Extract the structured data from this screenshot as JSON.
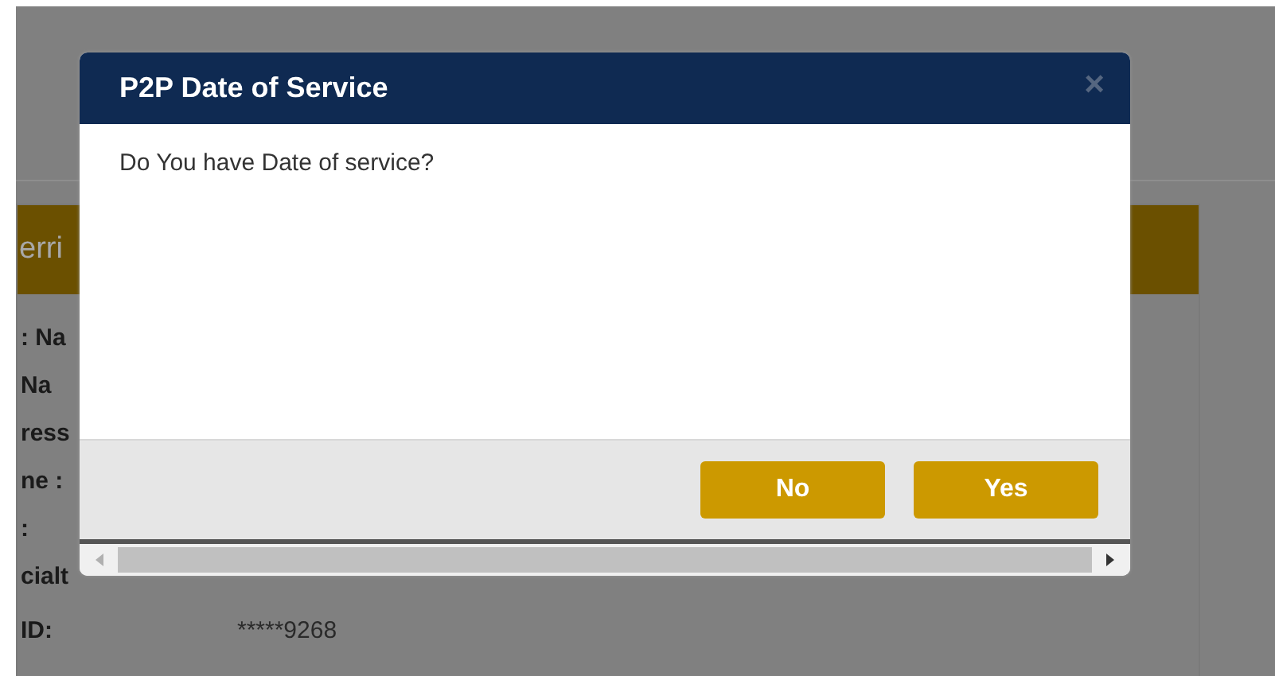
{
  "page": {
    "panel_header": "erri",
    "fields": [
      {
        "label": ": Na"
      },
      {
        "label": "Na"
      },
      {
        "label": "ress"
      },
      {
        "label": "ne :"
      },
      {
        "label": ":"
      },
      {
        "label": "cialt"
      },
      {
        "label": "ID:",
        "value": "*****9268"
      }
    ]
  },
  "dialog": {
    "title": "P2P Date of Service",
    "close": "×",
    "message": "Do You have Date of service?",
    "buttons": [
      "No",
      "Yes"
    ]
  }
}
